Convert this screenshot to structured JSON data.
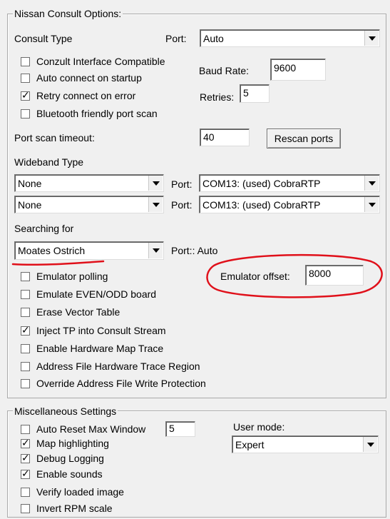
{
  "consult": {
    "group_title": "Nissan Consult Options:",
    "consult_type_label": "Consult Type",
    "port_label": "Port:",
    "port_value": "Auto",
    "checkboxes": [
      {
        "label": "Conzult Interface Compatible",
        "checked": false
      },
      {
        "label": "Auto connect on startup",
        "checked": false
      },
      {
        "label": "Retry connect on error",
        "checked": true
      },
      {
        "label": "Bluetooth friendly port scan",
        "checked": false
      }
    ],
    "baud_rate_label": "Baud Rate:",
    "baud_rate_value": "9600",
    "retries_label": "Retries:",
    "retries_value": "5",
    "port_scan_timeout_label": "Port scan timeout:",
    "port_scan_timeout_value": "40",
    "rescan_button": "Rescan ports",
    "wideband_label": "Wideband Type",
    "wideband_rows": [
      {
        "type": "None",
        "port_label": "Port:",
        "port": "COM13: (used) CobraRTP"
      },
      {
        "type": "None",
        "port_label": "Port:",
        "port": "COM13: (used) CobraRTP"
      }
    ],
    "searching_for_label": "Searching for",
    "searching_for_value": "Moates Ostrich",
    "searching_port_text": "Port:: Auto",
    "emulator_offset_label": "Emulator offset:",
    "emulator_offset_value": "8000",
    "emulator_checkboxes": [
      {
        "label": "Emulator polling",
        "checked": false
      },
      {
        "label": "Emulate EVEN/ODD board",
        "checked": false
      },
      {
        "label": "Erase Vector Table",
        "checked": false
      },
      {
        "label": "Inject TP into Consult Stream",
        "checked": true
      },
      {
        "label": "Enable Hardware Map Trace",
        "checked": false
      },
      {
        "label": "Address File Hardware Trace Region",
        "checked": false
      },
      {
        "label": "Override Address File Write Protection",
        "checked": false
      }
    ]
  },
  "misc": {
    "group_title": "Miscellaneous Settings",
    "checkboxes": [
      {
        "label": "Auto Reset Max Window",
        "checked": false
      },
      {
        "label": "Map highlighting",
        "checked": true
      },
      {
        "label": "Debug Logging",
        "checked": true
      },
      {
        "label": "Enable sounds",
        "checked": true
      },
      {
        "label": "Verify loaded image",
        "checked": false
      },
      {
        "label": "Invert RPM scale",
        "checked": false
      }
    ],
    "max_window_value": "5",
    "user_mode_label": "User mode:",
    "user_mode_value": "Expert"
  },
  "colors": {
    "annotation": "#e0101a"
  }
}
